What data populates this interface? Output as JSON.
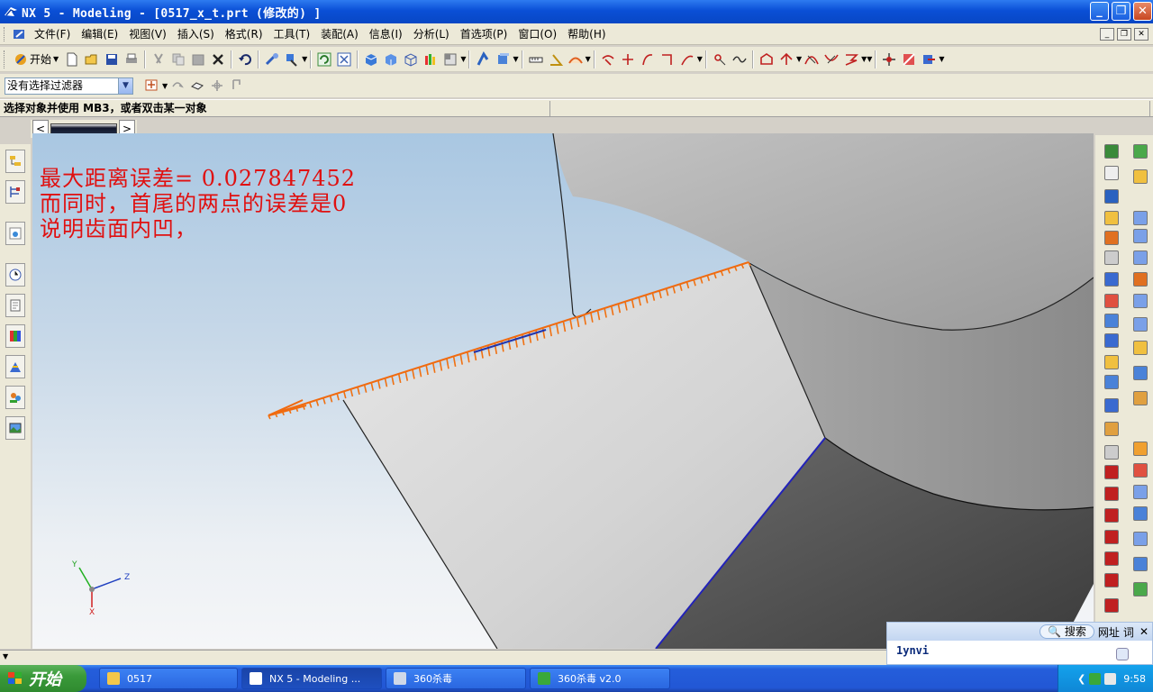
{
  "window": {
    "title": "NX 5 - Modeling - [0517_x_t.prt  (修改的) ]"
  },
  "menu": [
    "文件(F)",
    "编辑(E)",
    "视图(V)",
    "插入(S)",
    "格式(R)",
    "工具(T)",
    "装配(A)",
    "信息(I)",
    "分析(L)",
    "首选项(P)",
    "窗口(O)",
    "帮助(H)"
  ],
  "toolbar": {
    "start_label": "开始",
    "filter_value": "没有选择过滤器"
  },
  "status_line": "选择对象并使用 MB3，或者双击某一对象",
  "annotation": {
    "line1": "最大距离误差= 0.027847452",
    "line2": "而同时，首尾的两点的误差是0",
    "line3": "说明齿面内凹，"
  },
  "triad": {
    "y": "Y",
    "z": "Z",
    "x": "X"
  },
  "search_widget": {
    "search_label": "搜索",
    "web_label": "网址",
    "word_label": "词",
    "query": "1ynvi"
  },
  "taskbar": {
    "start_label": "开始",
    "tasks": [
      "0517",
      "NX 5 - Modeling ...",
      "360杀毒",
      "360杀毒 v2.0"
    ],
    "clock": "9:58"
  }
}
